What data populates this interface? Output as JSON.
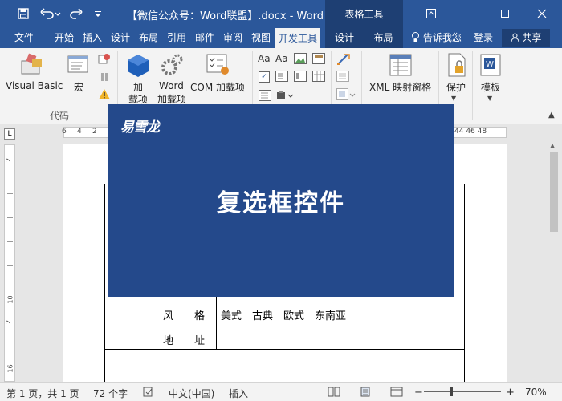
{
  "titlebar": {
    "doc_title": "【微信公众号：Word联盟】.docx - Word",
    "context_tools": "表格工具",
    "qa_save_icon": "save-icon",
    "qa_undo_icon": "undo-icon",
    "qa_redo_icon": "redo-icon"
  },
  "tabs": [
    {
      "label": "文件"
    },
    {
      "label": "开始"
    },
    {
      "label": "插入"
    },
    {
      "label": "设计"
    },
    {
      "label": "布局"
    },
    {
      "label": "引用"
    },
    {
      "label": "邮件"
    },
    {
      "label": "审阅"
    },
    {
      "label": "视图"
    },
    {
      "label": "开发工具"
    },
    {
      "label": "设计"
    },
    {
      "label": "布局"
    }
  ],
  "tell_me": "告诉我您",
  "login": "登录",
  "share": "共享",
  "ribbon": {
    "visual_basic": "Visual Basic",
    "macro": "宏",
    "code_group": "代码",
    "addins_line1": "加",
    "addins_line2": "载项",
    "word_addins_line1": "Word",
    "word_addins_line2": "加载项",
    "com_addins": "COM 加载项",
    "xml_pane": "XML 映射窗格",
    "protect": "保护",
    "template": "模板"
  },
  "ruler": {
    "top_left": [
      "6",
      "4",
      "2"
    ],
    "top_right": "44 46 48",
    "left": [
      "2",
      "10",
      "2",
      "16"
    ]
  },
  "table": {
    "style_label": "风　　格",
    "style_options": "美式　古典　欧式　东南亚",
    "address_label": "地　　址"
  },
  "banner": {
    "brand": "易雪龙",
    "headline": "复选框控件",
    "color": "#24498b"
  },
  "status": {
    "page": "第 1 页，共 1 页",
    "words": "72 个字",
    "lang": "中文(中国)",
    "mode": "插入",
    "zoom": "70%"
  }
}
